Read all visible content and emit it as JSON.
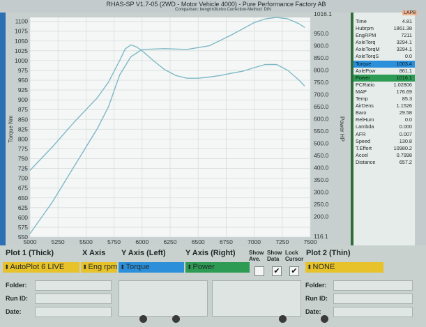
{
  "app": {
    "title": "RHAS-SP V1.7-05   (2WD - Motor Vehicle 4000) - Pure Performance Factory AB",
    "subtitle": "Comparison: bengtm3turbo    Correction-Method: DIN"
  },
  "colors": {
    "accent_blue": "#2c8fd9",
    "accent_green": "#2e9b55",
    "select_yellow": "#e7c22a",
    "curve": "#7fb8c6"
  },
  "chart_data": {
    "type": "line",
    "x_ticks": [
      "5000",
      "5250",
      "5500",
      "5750",
      "6000",
      "6250",
      "6500",
      "6750",
      "7000",
      "7250",
      "7500"
    ],
    "y_left_ticks": [
      "550",
      "575",
      "600",
      "625",
      "650",
      "675",
      "700",
      "725",
      "750",
      "775",
      "800",
      "825",
      "850",
      "875",
      "900",
      "925",
      "950",
      "975",
      "1000",
      "1025",
      "1050",
      "1075",
      "1100"
    ],
    "y_right_ticks": [
      "116.1",
      "200.0",
      "250.0",
      "300.0",
      "350.0",
      "400.0",
      "450.0",
      "500.0",
      "550.0",
      "600.0",
      "650.0",
      "700.0",
      "750.0",
      "800.0",
      "850.0",
      "900.0",
      "950.0",
      "1016.1"
    ],
    "ylabel_left": "Torque Nm",
    "ylabel_right": "Power HP",
    "xlim": [
      5000,
      7500
    ],
    "ylim_left": [
      550,
      1110
    ],
    "ylim_right": [
      116.1,
      1016.1
    ],
    "series": [
      {
        "name": "Torque",
        "axis": "left",
        "x": [
          5000,
          5200,
          5400,
          5600,
          5700,
          5800,
          5850,
          5900,
          5950,
          6000,
          6100,
          6200,
          6300,
          6400,
          6500,
          6600,
          6700,
          6800,
          6900,
          7000,
          7100,
          7200,
          7300,
          7400,
          7450
        ],
        "y": [
          720,
          780,
          845,
          905,
          945,
          1000,
          1030,
          1040,
          1035,
          1025,
          1000,
          977,
          962,
          955,
          955,
          958,
          962,
          968,
          973,
          982,
          990,
          990,
          975,
          950,
          935
        ]
      },
      {
        "name": "Power",
        "axis": "right",
        "x": [
          5000,
          5200,
          5400,
          5600,
          5700,
          5800,
          5900,
          6000,
          6200,
          6400,
          6600,
          6800,
          7000,
          7100,
          7200,
          7300,
          7400,
          7450
        ],
        "y": [
          130,
          260,
          410,
          560,
          650,
          780,
          855,
          885,
          888,
          885,
          900,
          945,
          995,
          1010,
          1016,
          1010,
          990,
          975
        ]
      }
    ]
  },
  "panel": {
    "header": "LAP8",
    "rows": [
      {
        "label": "Time",
        "value": "4.81"
      },
      {
        "label": "Hubrpm",
        "value": "1861.38"
      },
      {
        "label": "EngRPM",
        "value": "7211"
      },
      {
        "label": "AxleTorq",
        "value": "3294.1"
      },
      {
        "label": "AxleTorqM",
        "value": "3294.1"
      },
      {
        "label": "AxleTorqS",
        "value": "0.0"
      },
      {
        "label": "Torque",
        "value": "1003.4",
        "hl": "blue"
      },
      {
        "label": "AxlePow",
        "value": "861.1"
      },
      {
        "label": "Power",
        "value": "1016.1",
        "hl": "green"
      },
      {
        "label": "PCRatio",
        "value": "1.02806"
      },
      {
        "label": "MAP",
        "value": "176.69"
      },
      {
        "label": "Temp",
        "value": "85.3"
      },
      {
        "label": "AirDens",
        "value": "1.1526"
      },
      {
        "label": "Baro",
        "value": "29.58"
      },
      {
        "label": "RelHum",
        "value": "0.0"
      },
      {
        "label": "Lambda",
        "value": "0.000"
      },
      {
        "label": "AFR",
        "value": "0.007"
      },
      {
        "label": "Speed",
        "value": "130.8"
      },
      {
        "label": "T.Effort",
        "value": "10980.2"
      },
      {
        "label": "Accel",
        "value": "0.7998"
      },
      {
        "label": "Distance",
        "value": "657.2"
      }
    ]
  },
  "controls": {
    "plot1_header": "Plot 1 (Thick)",
    "plot1_value": "AutoPlot 6 LIVE",
    "xaxis_header": "X Axis",
    "xaxis_value": "Eng rpm",
    "yleft_header": "Y Axis (Left)",
    "yleft_value": "Torque",
    "yright_header": "Y Axis (Right)",
    "yright_value": "Power",
    "show_ave_label": "Show Ave.",
    "show_data_label": "Show Data",
    "lock_cursor_label": "Lock Cursor",
    "plot2_header": "Plot 2 (Thin)",
    "plot2_value": "NONE",
    "show_data_checked": "✔",
    "lock_cursor_checked": "✔",
    "arrow": "⬍"
  },
  "fields": {
    "folder_label": "Folder:",
    "runid_label": "Run ID:",
    "date_label": "Date:"
  }
}
